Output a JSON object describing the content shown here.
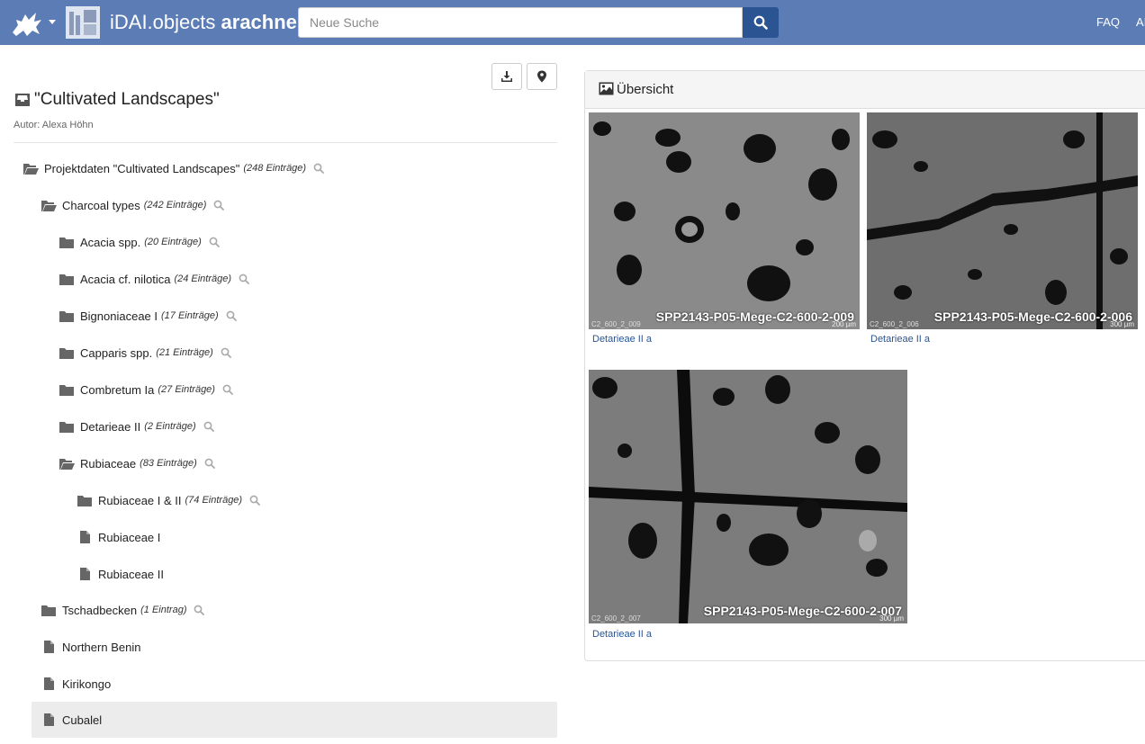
{
  "navbar": {
    "brand_prefix": "iDAI.objects",
    "brand_name": "arachne",
    "search_placeholder": "Neue Suche",
    "faq": "FAQ",
    "more": "AI"
  },
  "project": {
    "title": "\"Cultivated Landscapes\"",
    "author": "Autor: Alexa Höhn"
  },
  "tree": [
    {
      "label": "Projektdaten \"Cultivated Landscapes\"",
      "count": "(248 Einträge)",
      "icon": "folder-open-icon"
    },
    {
      "label": "Charcoal types",
      "count": "(242 Einträge)",
      "icon": "folder-open-icon"
    },
    {
      "label": "Acacia spp.",
      "count": "(20 Einträge)",
      "icon": "folder-icon"
    },
    {
      "label": "Acacia cf. nilotica",
      "count": "(24 Einträge)",
      "icon": "folder-icon"
    },
    {
      "label": "Bignoniaceae I",
      "count": "(17 Einträge)",
      "icon": "folder-icon"
    },
    {
      "label": "Capparis spp.",
      "count": "(21 Einträge)",
      "icon": "folder-icon"
    },
    {
      "label": "Combretum Ia",
      "count": "(27 Einträge)",
      "icon": "folder-icon"
    },
    {
      "label": "Detarieae II",
      "count": "(2 Einträge)",
      "icon": "folder-icon"
    },
    {
      "label": "Rubiaceae",
      "count": "(83 Einträge)",
      "icon": "folder-open-icon"
    },
    {
      "label": "Rubiaceae I & II",
      "count": "(74 Einträge)",
      "icon": "folder-icon"
    },
    {
      "label": "Rubiaceae I",
      "count": "",
      "icon": "file-icon"
    },
    {
      "label": "Rubiaceae II",
      "count": "",
      "icon": "file-icon"
    },
    {
      "label": "Tschadbecken",
      "count": "(1 Eintrag)",
      "icon": "folder-icon"
    },
    {
      "label": "Northern Benin",
      "count": "",
      "icon": "file-icon"
    },
    {
      "label": "Kirikongo",
      "count": "",
      "icon": "file-icon"
    },
    {
      "label": "Cubalel",
      "count": "",
      "icon": "file-icon"
    }
  ],
  "overview": {
    "title": "Übersicht",
    "images": [
      {
        "title": "SPP2143-P05-Mege-C2-600-2-009",
        "code": "C2_600_2_009",
        "scale": "200 µm",
        "caption": "Detarieae II a"
      },
      {
        "title": "SPP2143-P05-Mege-C2-600-2-006",
        "code": "C2_600_2_006",
        "scale": "300 µm",
        "caption": "Detarieae II a"
      },
      {
        "title": "SPP2143-P05-Mege-C2-600-2-007",
        "code": "C2_600_2_007",
        "scale": "300 µm",
        "caption": "Detarieae II a"
      }
    ]
  }
}
